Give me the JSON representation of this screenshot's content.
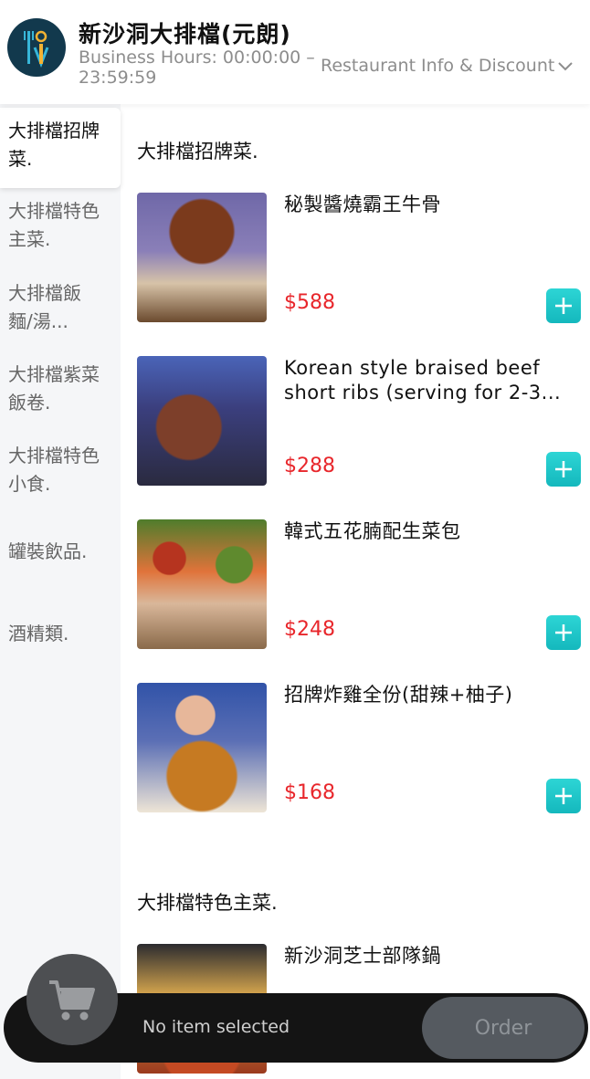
{
  "header": {
    "shop_name": "新沙洞大排檔(元朗)",
    "business_hours": "Business Hours: 00:00:00 – 23:59:59",
    "info_link": "Restaurant Info & Discount"
  },
  "sidebar": {
    "categories": [
      "大排檔招牌菜.",
      "大排檔特色主菜.",
      "大排檔飯麵/湯...",
      "大排檔紫菜飯卷.",
      "大排檔特色小食.",
      "罐裝飲品.",
      "酒精類."
    ]
  },
  "sections": [
    {
      "title": "大排檔招牌菜.",
      "items": [
        {
          "name": "秘製醬燒霸王牛骨",
          "price": "$588"
        },
        {
          "name": "Korean style braised beef short ribs (serving for 2-3...",
          "price": "$288"
        },
        {
          "name": "韓式五花腩配生菜包",
          "price": "$248"
        },
        {
          "name": "招牌炸雞全份(甜辣+柚子)",
          "price": "$168"
        }
      ]
    },
    {
      "title": "大排檔特色主菜.",
      "items": [
        {
          "name": "新沙洞芝士部隊鍋"
        }
      ]
    }
  ],
  "cart": {
    "status": "No item selected",
    "order_label": "Order"
  },
  "colors": {
    "accent": "#1cc6c9",
    "price": "#e8262b",
    "logo_bg": "#12394d",
    "cart_bar": "#141414"
  },
  "icons": [
    "logo-icon",
    "chevron-down-icon",
    "plus-icon",
    "cart-icon"
  ]
}
